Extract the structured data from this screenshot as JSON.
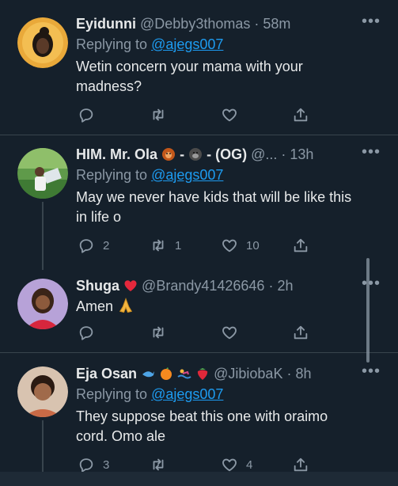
{
  "tweets": [
    {
      "name": "Eyidunni",
      "handle": "@Debby3thomas",
      "time": "· 58m",
      "reply_prefix": "Replying to ",
      "reply_to": "@ajegs007",
      "text": "Wetin concern your mama with your madness?",
      "reply_count": "",
      "retweet_count": "",
      "like_count": ""
    },
    {
      "name": "HIM. Mr. Ola",
      "name_suffix": "- (OG)",
      "handle": "@...",
      "time": "· 13h",
      "reply_prefix": "Replying to ",
      "reply_to": "@ajegs007",
      "text": "May we never have kids that will be like this in life o",
      "reply_count": "2",
      "retweet_count": "1",
      "like_count": "10"
    },
    {
      "name": "Shuga",
      "handle": "@Brandy41426646",
      "time": "· 2h",
      "text": "Amen",
      "reply_count": "",
      "retweet_count": "",
      "like_count": ""
    },
    {
      "name": "Eja Osan",
      "handle": "@JibiobaK",
      "time": "· 8h",
      "reply_prefix": "Replying to ",
      "reply_to": "@ajegs007",
      "text": "They suppose beat this one with oraimo cord. Omo ale",
      "reply_count": "3",
      "retweet_count": "",
      "like_count": "4"
    }
  ],
  "more_label": "•••",
  "colors": {
    "background": "#15202b",
    "link": "#1d9bf0",
    "muted": "#8b98a5",
    "like_red": "#f91880"
  },
  "icons": {
    "reply": "reply-icon",
    "retweet": "retweet-icon",
    "like": "heart-icon",
    "share": "share-icon"
  }
}
